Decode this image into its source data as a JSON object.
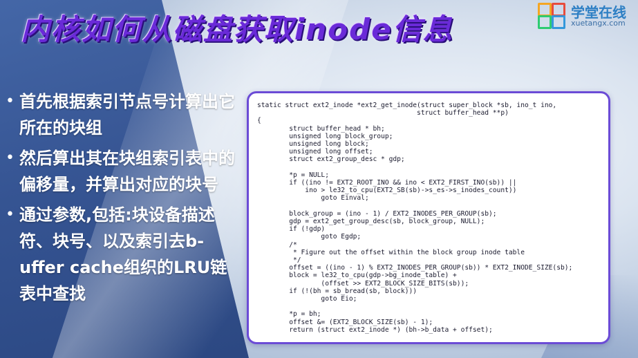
{
  "title": "内核如何从磁盘获取inode信息",
  "logo": {
    "text": "学堂在线",
    "subtext": "xuetangx.com"
  },
  "bullets": [
    {
      "text": "首先根据索引节点号计算出它所在的块组"
    },
    {
      "text": "然后算出其在块组索引表中的偏移量，并算出对应的块号"
    },
    {
      "text": "通过参数,包括:块设备描述符、块号、以及索引去b-uffer cache组织的LRU链表中查找"
    }
  ],
  "code_lines": [
    "static struct ext2_inode *ext2_get_inode(struct super_block *sb, ino_t ino,",
    "                                        struct buffer_head **p)",
    "{",
    "        struct buffer_head * bh;",
    "        unsigned long block_group;",
    "        unsigned long block;",
    "        unsigned long offset;",
    "        struct ext2_group_desc * gdp;",
    "",
    "        *p = NULL;",
    "        if ((ino != EXT2_ROOT_INO && ino < EXT2_FIRST_INO(sb)) ||",
    "            ino > le32_to_cpu(EXT2_SB(sb)->s_es->s_inodes_count))",
    "                goto Einval;",
    "",
    "        block_group = (ino - 1) / EXT2_INODES_PER_GROUP(sb);",
    "        gdp = ext2_get_group_desc(sb, block_group, NULL);",
    "        if (!gdp)",
    "                goto Egdp;",
    "        /*",
    "         * Figure out the offset within the block group inode table",
    "         */",
    "        offset = ((ino - 1) % EXT2_INODES_PER_GROUP(sb)) * EXT2_INODE_SIZE(sb);",
    "        block = le32_to_cpu(gdp->bg_inode_table) +",
    "                (offset >> EXT2_BLOCK_SIZE_BITS(sb));",
    "        if (!(bh = sb_bread(sb, block)))",
    "                goto Eio;",
    "",
    "        *p = bh;",
    "        offset &= (EXT2_BLOCK_SIZE(sb) - 1);",
    "        return (struct ext2_inode *) (bh->b_data + offset);"
  ]
}
